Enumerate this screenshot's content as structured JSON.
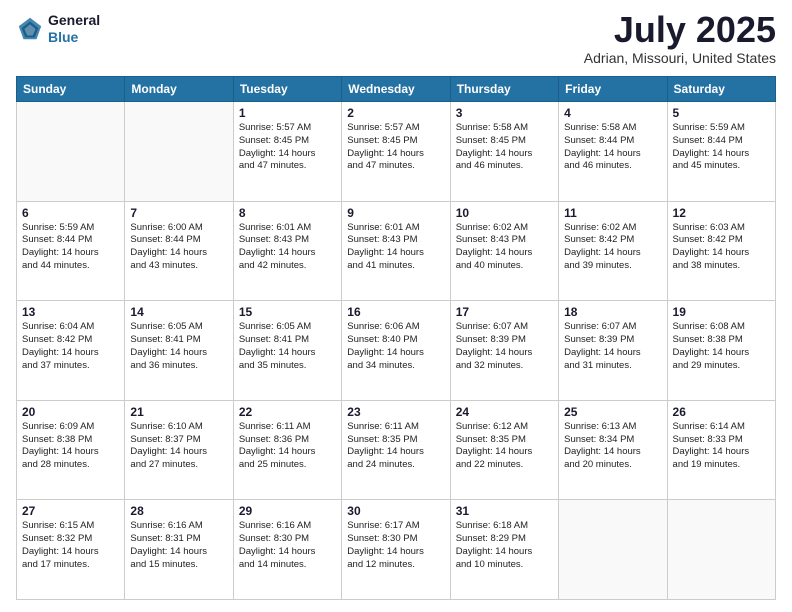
{
  "header": {
    "logo_line1": "General",
    "logo_line2": "Blue",
    "month": "July 2025",
    "location": "Adrian, Missouri, United States"
  },
  "weekdays": [
    "Sunday",
    "Monday",
    "Tuesday",
    "Wednesday",
    "Thursday",
    "Friday",
    "Saturday"
  ],
  "weeks": [
    [
      {
        "day": "",
        "info": ""
      },
      {
        "day": "",
        "info": ""
      },
      {
        "day": "1",
        "info": "Sunrise: 5:57 AM\nSunset: 8:45 PM\nDaylight: 14 hours\nand 47 minutes."
      },
      {
        "day": "2",
        "info": "Sunrise: 5:57 AM\nSunset: 8:45 PM\nDaylight: 14 hours\nand 47 minutes."
      },
      {
        "day": "3",
        "info": "Sunrise: 5:58 AM\nSunset: 8:45 PM\nDaylight: 14 hours\nand 46 minutes."
      },
      {
        "day": "4",
        "info": "Sunrise: 5:58 AM\nSunset: 8:44 PM\nDaylight: 14 hours\nand 46 minutes."
      },
      {
        "day": "5",
        "info": "Sunrise: 5:59 AM\nSunset: 8:44 PM\nDaylight: 14 hours\nand 45 minutes."
      }
    ],
    [
      {
        "day": "6",
        "info": "Sunrise: 5:59 AM\nSunset: 8:44 PM\nDaylight: 14 hours\nand 44 minutes."
      },
      {
        "day": "7",
        "info": "Sunrise: 6:00 AM\nSunset: 8:44 PM\nDaylight: 14 hours\nand 43 minutes."
      },
      {
        "day": "8",
        "info": "Sunrise: 6:01 AM\nSunset: 8:43 PM\nDaylight: 14 hours\nand 42 minutes."
      },
      {
        "day": "9",
        "info": "Sunrise: 6:01 AM\nSunset: 8:43 PM\nDaylight: 14 hours\nand 41 minutes."
      },
      {
        "day": "10",
        "info": "Sunrise: 6:02 AM\nSunset: 8:43 PM\nDaylight: 14 hours\nand 40 minutes."
      },
      {
        "day": "11",
        "info": "Sunrise: 6:02 AM\nSunset: 8:42 PM\nDaylight: 14 hours\nand 39 minutes."
      },
      {
        "day": "12",
        "info": "Sunrise: 6:03 AM\nSunset: 8:42 PM\nDaylight: 14 hours\nand 38 minutes."
      }
    ],
    [
      {
        "day": "13",
        "info": "Sunrise: 6:04 AM\nSunset: 8:42 PM\nDaylight: 14 hours\nand 37 minutes."
      },
      {
        "day": "14",
        "info": "Sunrise: 6:05 AM\nSunset: 8:41 PM\nDaylight: 14 hours\nand 36 minutes."
      },
      {
        "day": "15",
        "info": "Sunrise: 6:05 AM\nSunset: 8:41 PM\nDaylight: 14 hours\nand 35 minutes."
      },
      {
        "day": "16",
        "info": "Sunrise: 6:06 AM\nSunset: 8:40 PM\nDaylight: 14 hours\nand 34 minutes."
      },
      {
        "day": "17",
        "info": "Sunrise: 6:07 AM\nSunset: 8:39 PM\nDaylight: 14 hours\nand 32 minutes."
      },
      {
        "day": "18",
        "info": "Sunrise: 6:07 AM\nSunset: 8:39 PM\nDaylight: 14 hours\nand 31 minutes."
      },
      {
        "day": "19",
        "info": "Sunrise: 6:08 AM\nSunset: 8:38 PM\nDaylight: 14 hours\nand 29 minutes."
      }
    ],
    [
      {
        "day": "20",
        "info": "Sunrise: 6:09 AM\nSunset: 8:38 PM\nDaylight: 14 hours\nand 28 minutes."
      },
      {
        "day": "21",
        "info": "Sunrise: 6:10 AM\nSunset: 8:37 PM\nDaylight: 14 hours\nand 27 minutes."
      },
      {
        "day": "22",
        "info": "Sunrise: 6:11 AM\nSunset: 8:36 PM\nDaylight: 14 hours\nand 25 minutes."
      },
      {
        "day": "23",
        "info": "Sunrise: 6:11 AM\nSunset: 8:35 PM\nDaylight: 14 hours\nand 24 minutes."
      },
      {
        "day": "24",
        "info": "Sunrise: 6:12 AM\nSunset: 8:35 PM\nDaylight: 14 hours\nand 22 minutes."
      },
      {
        "day": "25",
        "info": "Sunrise: 6:13 AM\nSunset: 8:34 PM\nDaylight: 14 hours\nand 20 minutes."
      },
      {
        "day": "26",
        "info": "Sunrise: 6:14 AM\nSunset: 8:33 PM\nDaylight: 14 hours\nand 19 minutes."
      }
    ],
    [
      {
        "day": "27",
        "info": "Sunrise: 6:15 AM\nSunset: 8:32 PM\nDaylight: 14 hours\nand 17 minutes."
      },
      {
        "day": "28",
        "info": "Sunrise: 6:16 AM\nSunset: 8:31 PM\nDaylight: 14 hours\nand 15 minutes."
      },
      {
        "day": "29",
        "info": "Sunrise: 6:16 AM\nSunset: 8:30 PM\nDaylight: 14 hours\nand 14 minutes."
      },
      {
        "day": "30",
        "info": "Sunrise: 6:17 AM\nSunset: 8:30 PM\nDaylight: 14 hours\nand 12 minutes."
      },
      {
        "day": "31",
        "info": "Sunrise: 6:18 AM\nSunset: 8:29 PM\nDaylight: 14 hours\nand 10 minutes."
      },
      {
        "day": "",
        "info": ""
      },
      {
        "day": "",
        "info": ""
      }
    ]
  ]
}
